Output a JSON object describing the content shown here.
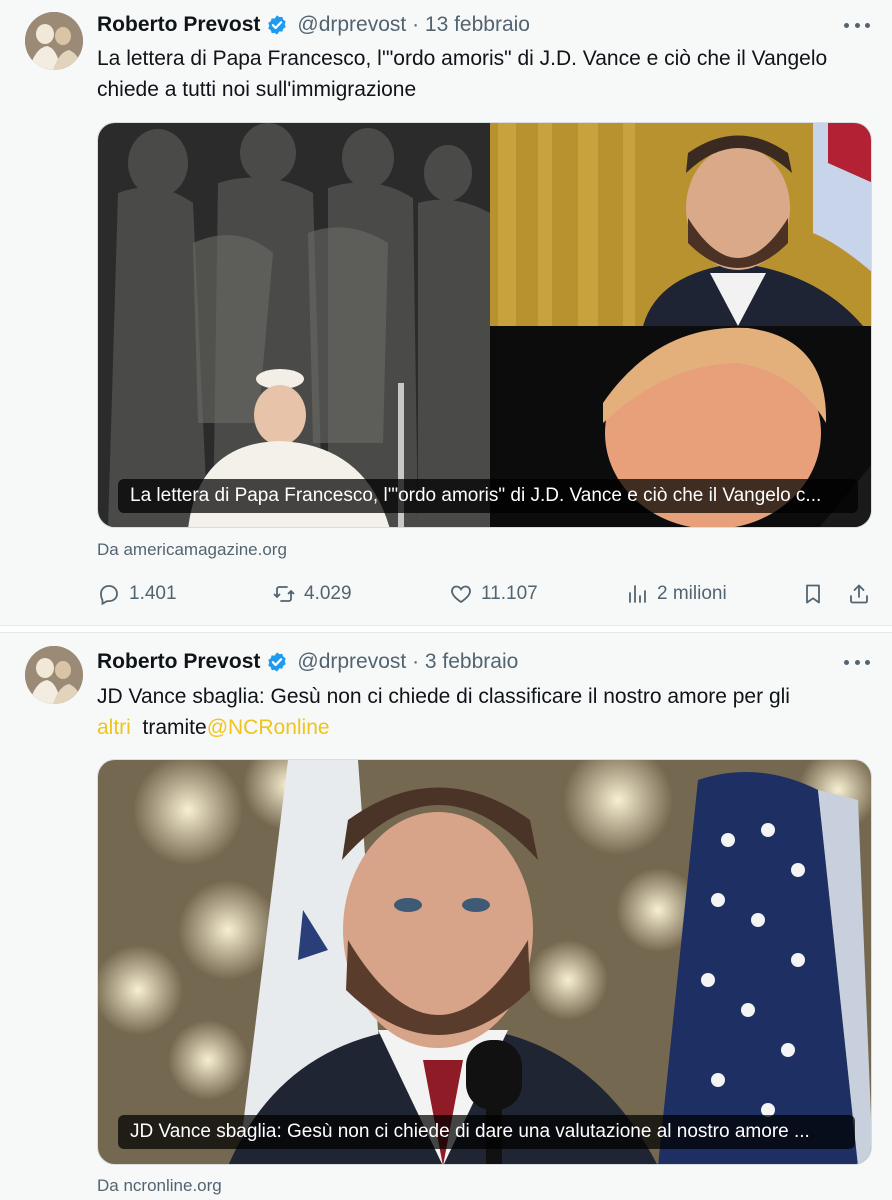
{
  "tweets": [
    {
      "author": "Roberto Prevost",
      "handle": "@drprevost",
      "date": "13 febbraio",
      "text": "La lettera di Papa Francesco, l'\"ordo amoris\" di J.D. Vance e ciò che il Vangelo chiede a tutti noi sull'immigrazione",
      "card_caption": "La lettera di Papa Francesco, l'\"ordo amoris\" di J.D. Vance e ciò che il Vangelo c...",
      "source": "Da americamagazine.org",
      "stats": {
        "replies": "1.401",
        "reposts": "4.029",
        "likes": "11.107",
        "views": "2 milioni"
      }
    },
    {
      "author": "Roberto Prevost",
      "handle": "@drprevost",
      "date": "3 febbraio",
      "text_main": "JD Vance sbaglia: Gesù non ci chiede di classificare il nostro amore per gli",
      "text_link_word": "altri",
      "text_via": "tramite",
      "text_mention": "@NCRonline",
      "card_caption": "JD Vance sbaglia: Gesù non ci chiede di dare una valutazione al nostro amore ...",
      "source": "Da ncronline.org"
    }
  ],
  "icons": [
    "verified-badge-icon",
    "more-icon",
    "reply-icon",
    "repost-icon",
    "like-icon",
    "views-icon",
    "bookmark-icon",
    "share-icon"
  ],
  "colors": {
    "verified": "#1d9bf0",
    "link": "#f0c419",
    "muted": "#536471",
    "text": "#0f1419"
  }
}
